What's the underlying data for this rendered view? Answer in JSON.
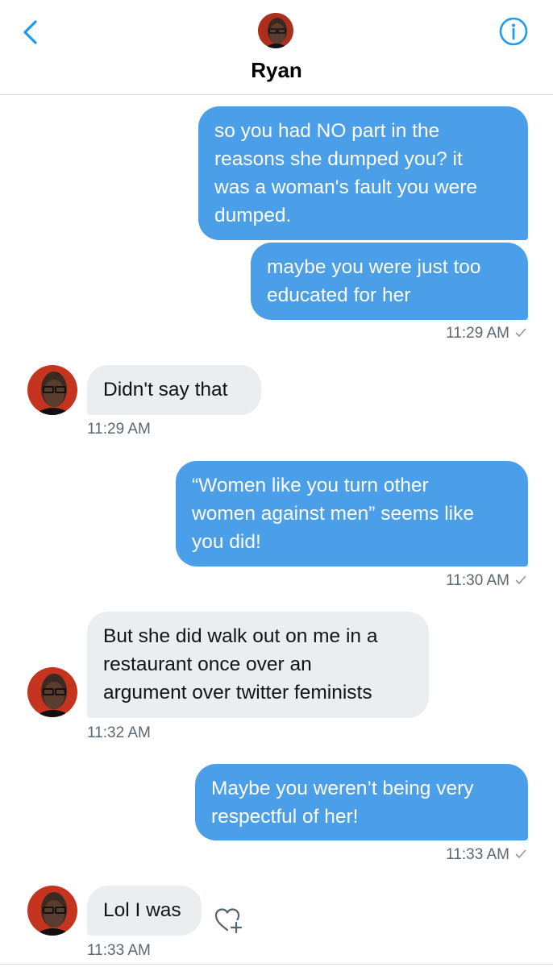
{
  "header": {
    "contact_name": "Ryan",
    "back_icon": "chevron-left-icon",
    "info_icon": "info-icon"
  },
  "colors": {
    "accent": "#1d9bf0",
    "sent_bubble": "#4b9ee8",
    "received_bubble": "#ebeef0",
    "timestamp": "#586874"
  },
  "messages": [
    {
      "direction": "sent",
      "text": "so you had NO part in the\nreasons she dumped you? it\nwas a woman's fault you were\ndumped."
    },
    {
      "direction": "sent",
      "text": "maybe you were just too\neducated for her",
      "time": "11:29 AM"
    },
    {
      "direction": "received",
      "text": "Didn't say that",
      "time": "11:29 AM"
    },
    {
      "direction": "sent",
      "text": "“Women like you turn other\nwomen against men” seems like\nyou did!",
      "time": "11:30 AM"
    },
    {
      "direction": "received",
      "text": "But she did walk out on me in a\nrestaurant once over an\nargument over twitter feminists",
      "time": "11:32 AM"
    },
    {
      "direction": "sent",
      "text": "Maybe you weren’t being very\nrespectful of her!",
      "time": "11:33 AM"
    },
    {
      "direction": "received",
      "text": "Lol I was",
      "time": "11:33 AM",
      "reaction_icon": "add-reaction-heart-icon"
    }
  ]
}
